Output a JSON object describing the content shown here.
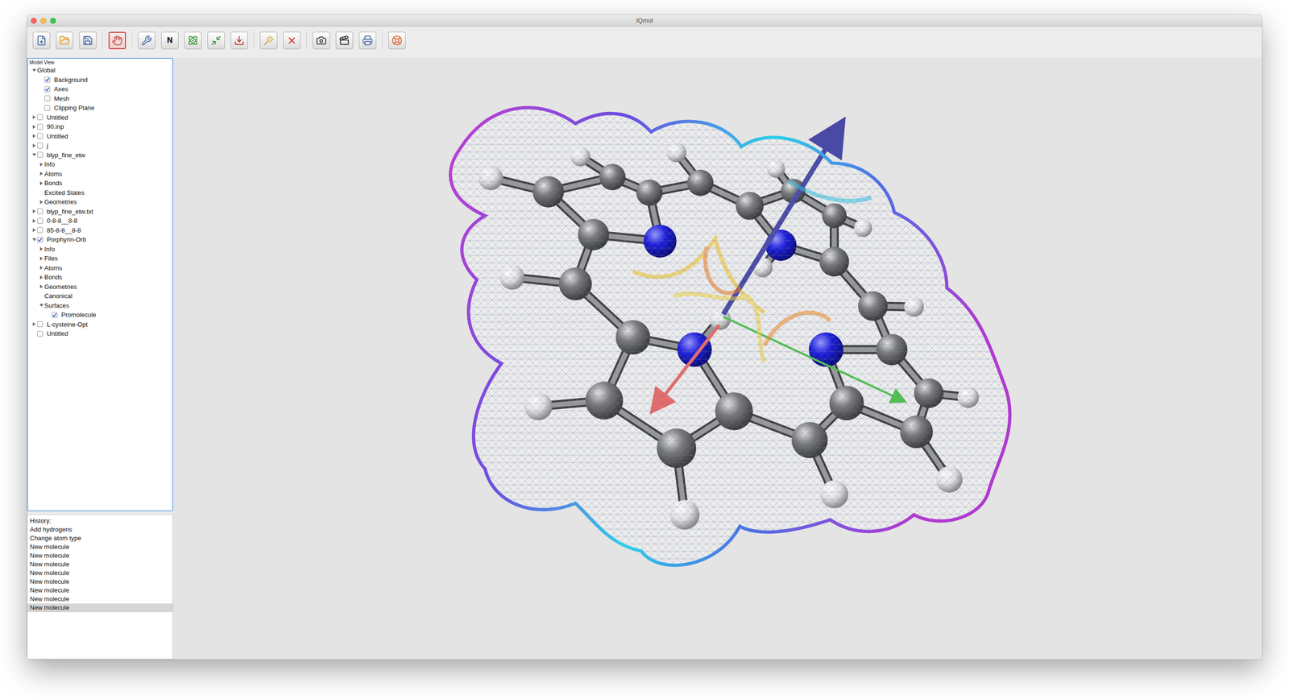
{
  "window": {
    "title": "IQmol"
  },
  "toolbar": [
    [
      {
        "selected": false
      },
      {
        "selected": false
      },
      {
        "selected": false
      }
    ],
    [
      {
        "selected": true
      }
    ],
    [
      {
        "selected": false
      },
      {
        "selected": false,
        "label": "N"
      },
      {
        "selected": false
      },
      {
        "selected": false
      },
      {
        "selected": false
      }
    ],
    [
      {
        "selected": false
      },
      {
        "selected": false
      }
    ],
    [
      {
        "selected": false
      },
      {
        "selected": false
      },
      {
        "selected": false
      }
    ],
    [
      {
        "selected": false
      }
    ]
  ],
  "model_view": {
    "title": "Model View",
    "items": [
      {
        "label": "Global",
        "checkable": false,
        "checked": false,
        "expandable": true,
        "expanded": true,
        "children": [
          {
            "label": "Background",
            "checkable": true,
            "checked": true,
            "expandable": false,
            "expanded": false
          },
          {
            "label": "Axes",
            "checkable": true,
            "checked": true,
            "expandable": false,
            "expanded": false
          },
          {
            "label": "Mesh",
            "checkable": true,
            "checked": false,
            "expandable": false,
            "expanded": false
          },
          {
            "label": "Clipping Plane",
            "checkable": true,
            "checked": false,
            "expandable": false,
            "expanded": false
          }
        ]
      },
      {
        "label": "Untitled",
        "checkable": true,
        "checked": false,
        "expandable": true,
        "expanded": false
      },
      {
        "label": "90.inp",
        "checkable": true,
        "checked": false,
        "expandable": true,
        "expanded": false
      },
      {
        "label": "Untitled",
        "checkable": true,
        "checked": false,
        "expandable": true,
        "expanded": false
      },
      {
        "label": "j",
        "checkable": true,
        "checked": false,
        "expandable": true,
        "expanded": false
      },
      {
        "label": "blyp_fine_etw",
        "checkable": true,
        "checked": false,
        "expandable": true,
        "expanded": true,
        "children": [
          {
            "label": "Info",
            "checkable": false,
            "checked": false,
            "expandable": true,
            "expanded": false
          },
          {
            "label": "Atoms",
            "checkable": false,
            "checked": false,
            "expandable": true,
            "expanded": false
          },
          {
            "label": "Bonds",
            "checkable": false,
            "checked": false,
            "expandable": true,
            "expanded": false
          },
          {
            "label": "Excited States",
            "checkable": false,
            "checked": false,
            "expandable": false,
            "expanded": false
          },
          {
            "label": "Geometries",
            "checkable": false,
            "checked": false,
            "expandable": true,
            "expanded": false
          }
        ]
      },
      {
        "label": "blyp_fine_etw.txt",
        "checkable": true,
        "checked": false,
        "expandable": true,
        "expanded": false
      },
      {
        "label": "0-8-8__8-8",
        "checkable": true,
        "checked": false,
        "expandable": true,
        "expanded": false
      },
      {
        "label": "85-8-8__8-8",
        "checkable": true,
        "checked": false,
        "expandable": true,
        "expanded": false
      },
      {
        "label": "Porphyrin-Orb",
        "checkable": true,
        "checked": true,
        "expandable": true,
        "expanded": true,
        "children": [
          {
            "label": "Info",
            "checkable": false,
            "checked": false,
            "expandable": true,
            "expanded": false
          },
          {
            "label": "Files",
            "checkable": false,
            "checked": false,
            "expandable": true,
            "expanded": false
          },
          {
            "label": "Atoms",
            "checkable": false,
            "checked": false,
            "expandable": true,
            "expanded": false
          },
          {
            "label": "Bonds",
            "checkable": false,
            "checked": false,
            "expandable": true,
            "expanded": false
          },
          {
            "label": "Geometries",
            "checkable": false,
            "checked": false,
            "expandable": true,
            "expanded": false
          },
          {
            "label": "Canonical",
            "checkable": false,
            "checked": false,
            "expandable": false,
            "expanded": false
          },
          {
            "label": "Surfaces",
            "checkable": false,
            "checked": false,
            "expandable": true,
            "expanded": true,
            "children": [
              {
                "label": "Promolecule",
                "checkable": true,
                "checked": true,
                "expandable": false,
                "expanded": false
              }
            ]
          }
        ]
      },
      {
        "label": "L-cysteine-Opt",
        "checkable": true,
        "checked": false,
        "expandable": true,
        "expanded": false
      },
      {
        "label": "Untitled",
        "checkable": true,
        "checked": false,
        "expandable": false,
        "expanded": false
      }
    ]
  },
  "history": {
    "title": "History:",
    "items": [
      {
        "label": "Add hydrogens",
        "selected": false
      },
      {
        "label": "Change atom type",
        "selected": false
      },
      {
        "label": "New molecule",
        "selected": false
      },
      {
        "label": "New molecule",
        "selected": false
      },
      {
        "label": "New molecule",
        "selected": false
      },
      {
        "label": "New molecule",
        "selected": false
      },
      {
        "label": "New molecule",
        "selected": false
      },
      {
        "label": "New molecule",
        "selected": false
      },
      {
        "label": "New molecule",
        "selected": false
      },
      {
        "label": "New molecule",
        "selected": true
      }
    ]
  }
}
